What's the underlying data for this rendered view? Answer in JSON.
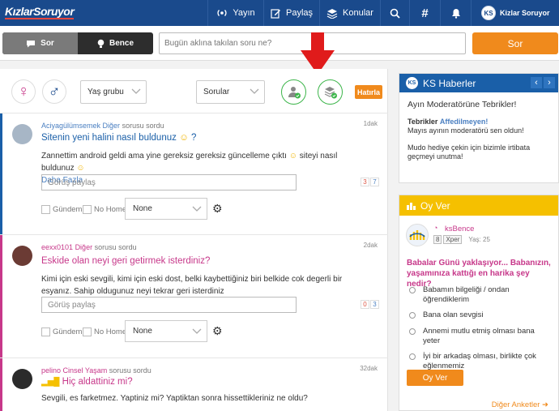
{
  "topbar": {
    "logo": "KızlarSoruyor",
    "nav": [
      {
        "label": "Yayın",
        "icon": "broadcast-icon"
      },
      {
        "label": "Paylaş",
        "icon": "edit-icon"
      },
      {
        "label": "Konular",
        "icon": "stack-icon"
      }
    ],
    "search_icon": "search-icon",
    "hashtag": "#",
    "bell_icon": "bell-icon",
    "user": {
      "avatar_text": "KS",
      "name": "Kizlar Soruyor"
    }
  },
  "askbar": {
    "toggle": [
      {
        "label": "Sor",
        "icon": "speech-bubble-icon",
        "active": true
      },
      {
        "label": "Bence",
        "icon": "lightbulb-icon",
        "active": false
      }
    ],
    "placeholder": "Bugün aklına takılan soru ne?",
    "submit_label": "Sor"
  },
  "filter": {
    "female_symbol": "♀",
    "male_symbol": "♂",
    "age_select": "Yaş grubu",
    "type_select": "Sorular",
    "remember_label": "Hatırla"
  },
  "posts": [
    {
      "username": "Aciyagülümsemek",
      "category": "Diğer",
      "action": "sorusu sordu",
      "age": "1dak",
      "title": "Sitenin yeni halini nasıl buldunuz",
      "title_suffix": "?",
      "body_1": "Zannettim android geldi ama yine gereksiz gereksiz güncelleme çıktı",
      "body_2": "siteyi nasıl buldunuz",
      "more": "Daha Fazla",
      "comment_placeholder": "Görüş paylaş",
      "count_a": "3",
      "count_b": "7",
      "check_1": "Gündem",
      "check_2": "No Home",
      "dropdown": "None",
      "accent": "#1a5fa8"
    },
    {
      "username": "eexx0101",
      "category": "Diğer",
      "action": "sorusu sordu",
      "age": "2dak",
      "title": "Eskide olan neyi geri getirmek isterdiniz?",
      "body_1": "Kimi için eski sevgili, kimi için eski dost, belki kaybettiğiniz biri belkide cok degerli bir esyanız. Sahip oldugunuz neyi tekrar geri isterdiniz",
      "comment_placeholder": "Görüş paylaş",
      "count_a": "0",
      "count_b": "3",
      "check_1": "Gündem",
      "check_2": "No Home",
      "dropdown": "None",
      "accent": "#c7388a"
    },
    {
      "username": "pelino",
      "category": "Cinsel Yaşam",
      "action": "sorusu sordu",
      "age": "32dak",
      "title": "Hiç aldattiniz mi?",
      "body_1": "Sevgili, es farketmez. Yaptiniz mi? Yaptiktan sonra hissettikleriniz ne oldu?",
      "accent": "#c7388a"
    }
  ],
  "ks_haberler": {
    "header": "KS Haberler",
    "title": "Ayın Moderatörüne Tebrikler!",
    "line_1_prefix": "Tebrikler",
    "line_1_name": "Affedilmeyen!",
    "line_2": "Mayıs ayının moderatörü sen oldun!",
    "line_3": "Mudo hediye çekin için bizimle irtibata geçmeyi unutma!"
  },
  "oy_ver": {
    "header": "Oy Ver",
    "user_name": "ksBence",
    "level": "8",
    "xper": "Xper",
    "age": "Yaş: 25",
    "question": "Babalar Günü yaklaşıyor... Babanızın, yaşamınıza kattığı en harika şey nedir?",
    "options": [
      "Babamın bilgeliği / ondan öğrendiklerim",
      "Bana olan sevgisi",
      "Annemi mutlu etmiş olması bana yeter",
      "İyi bir arkadaş olması, birlikte çok eğlenmemiz"
    ],
    "vote_label": "Oy Ver",
    "more_label": "Diğer Anketler"
  },
  "colors": {
    "brand_blue": "#1a4a8c",
    "accent_orange": "#f08a1c",
    "pink": "#c7388a",
    "green": "#3cb54a",
    "yellow": "#f5c000"
  }
}
